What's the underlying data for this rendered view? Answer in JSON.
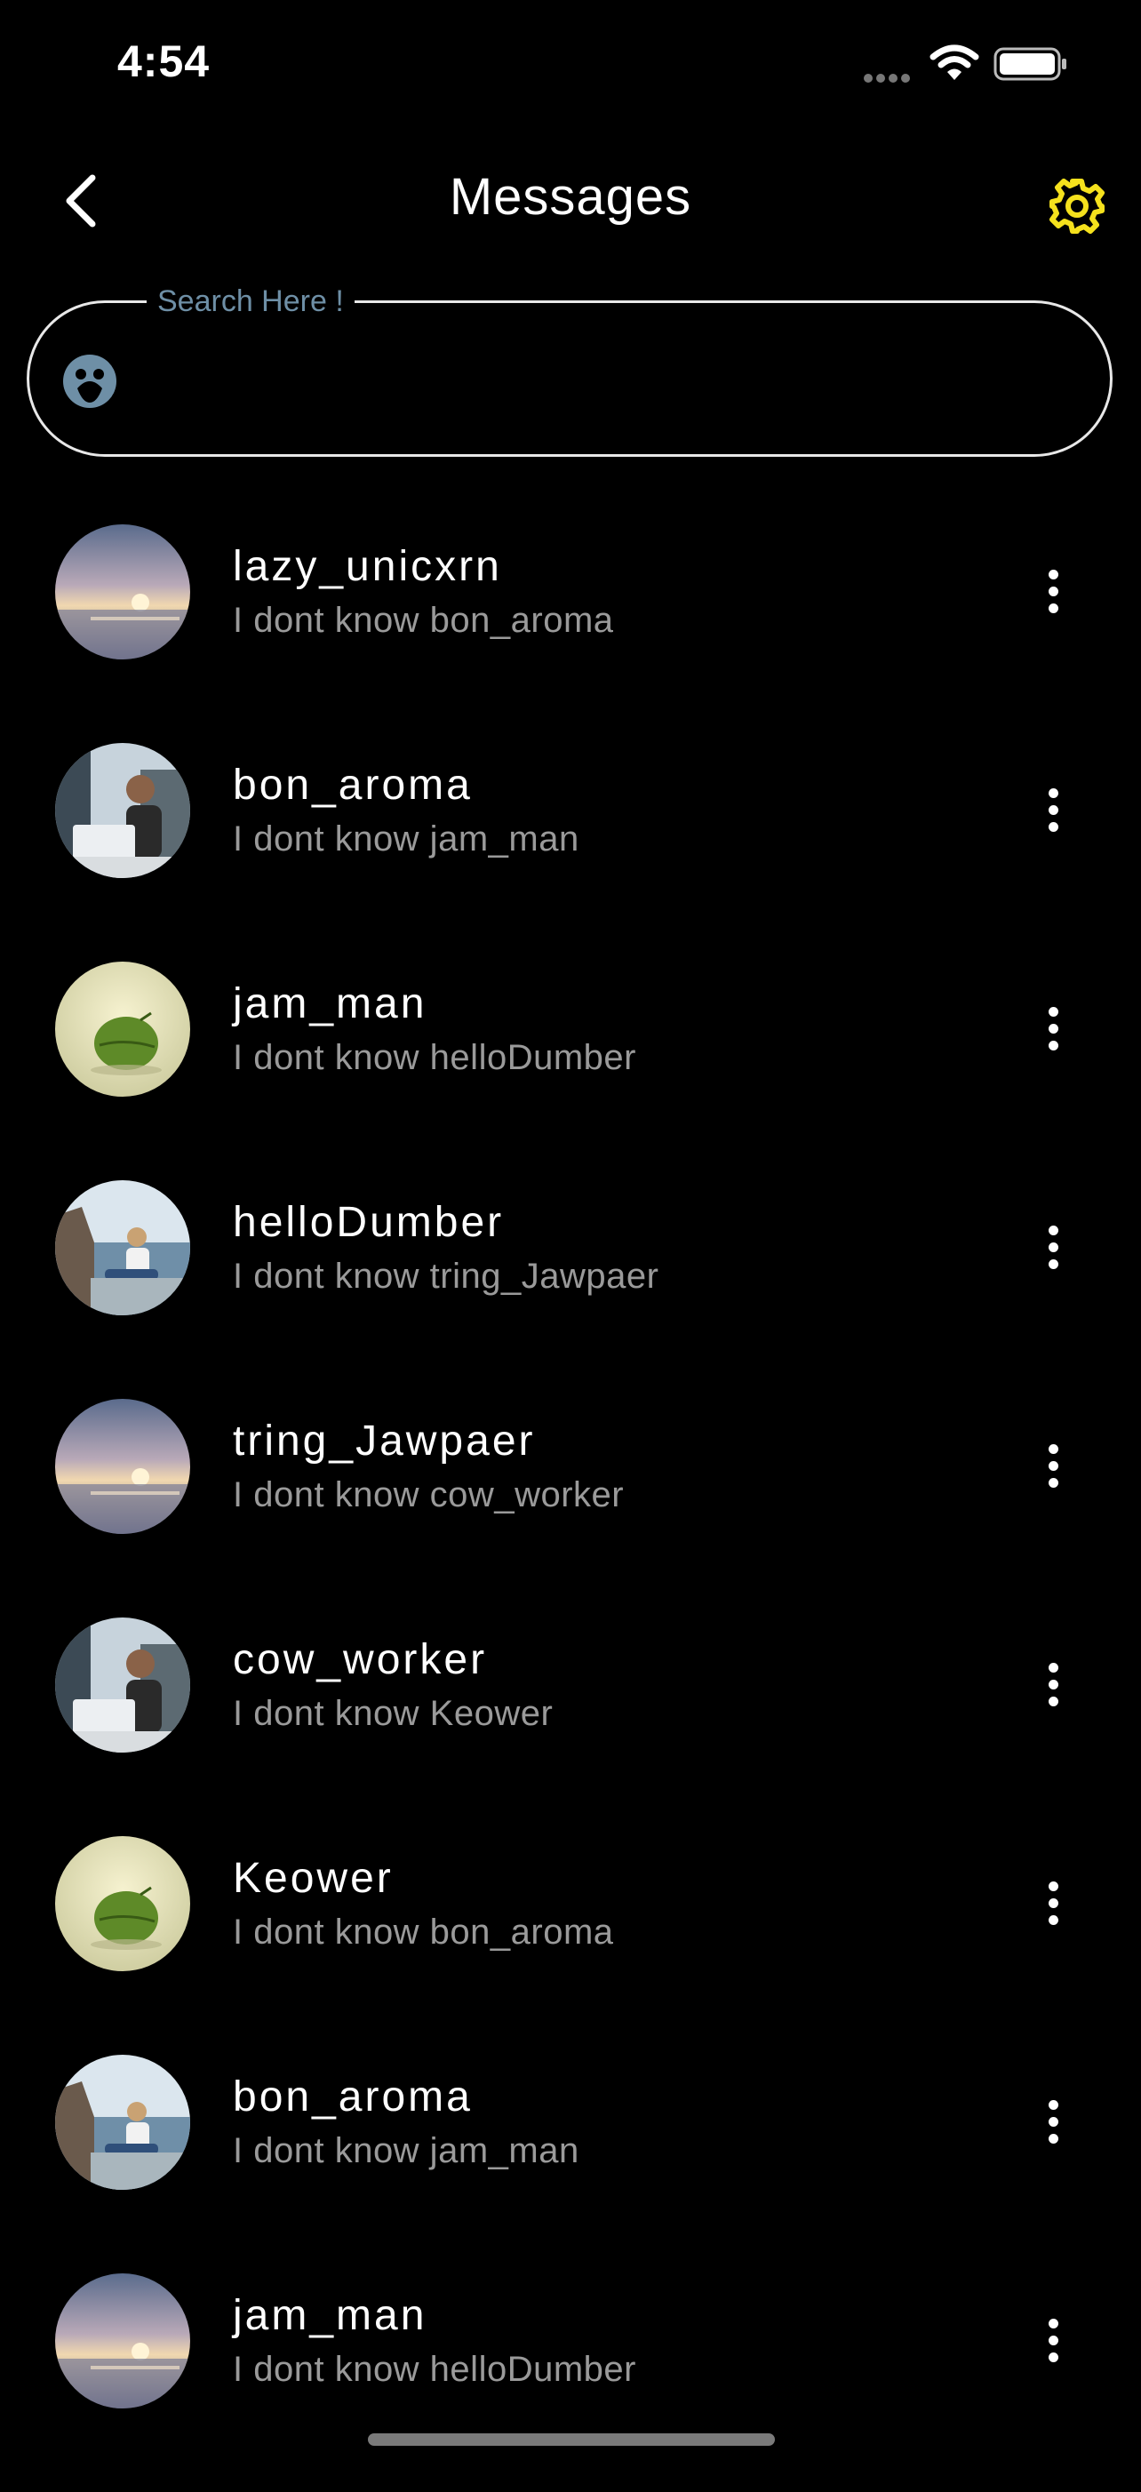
{
  "status_bar": {
    "time": "4:54"
  },
  "header": {
    "title": "Messages",
    "back_icon": "chevron-left-icon",
    "settings_icon": "gear-icon"
  },
  "search": {
    "label": "Search Here !",
    "value": "",
    "placeholder": "",
    "icon": "emoji-face-icon"
  },
  "colors": {
    "background": "#000000",
    "accent": "#f5e11d",
    "search_label": "#6e8fa6",
    "secondary_text": "#9a9a9a"
  },
  "messages": [
    {
      "name": "lazy_unicxrn",
      "preview": "I dont know bon_aroma",
      "avatar": "sunset"
    },
    {
      "name": "bon_aroma",
      "preview": "I dont know jam_man",
      "avatar": "laptop-man"
    },
    {
      "name": "jam_man",
      "preview": "I dont know helloDumber",
      "avatar": "leaf"
    },
    {
      "name": "helloDumber",
      "preview": "I dont know tring_Jawpaer",
      "avatar": "cliff-woman"
    },
    {
      "name": "tring_Jawpaer",
      "preview": "I dont know cow_worker",
      "avatar": "sunset"
    },
    {
      "name": "cow_worker",
      "preview": "I dont know Keower",
      "avatar": "laptop-man"
    },
    {
      "name": "Keower",
      "preview": "I dont know bon_aroma",
      "avatar": "leaf"
    },
    {
      "name": "bon_aroma",
      "preview": "I dont know jam_man",
      "avatar": "cliff-woman"
    },
    {
      "name": "jam_man",
      "preview": "I dont know helloDumber",
      "avatar": "sunset"
    }
  ]
}
